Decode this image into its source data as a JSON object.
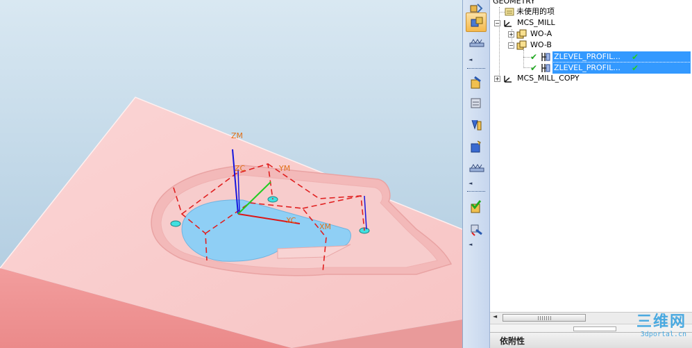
{
  "viewport": {
    "axis_labels": {
      "zm": "ZM",
      "zc": "ZC",
      "ym": "YM",
      "xc": "XC",
      "xm": "XM"
    }
  },
  "navigator": {
    "root_label": "GEOMETRY",
    "unused_label": "未使用的项",
    "items": [
      {
        "label": "MCS_MILL",
        "expander": "−"
      },
      {
        "label": "WO-A",
        "expander": "+"
      },
      {
        "label": "WO-B",
        "expander": "−"
      },
      {
        "label": "ZLEVEL_PROFIL..."
      },
      {
        "label": "ZLEVEL_PROFIL..."
      },
      {
        "label": "MCS_MILL_COPY",
        "expander": "+"
      }
    ]
  },
  "bottom_panel": {
    "title": "依附性"
  },
  "watermark": {
    "main": "三维网",
    "sub": "3dportal.cn"
  },
  "colors": {
    "selection": "#3399ff",
    "part": "#f6c2c2",
    "pocket_floor": "#8fcff5",
    "csys_dashed": "#e02020"
  }
}
